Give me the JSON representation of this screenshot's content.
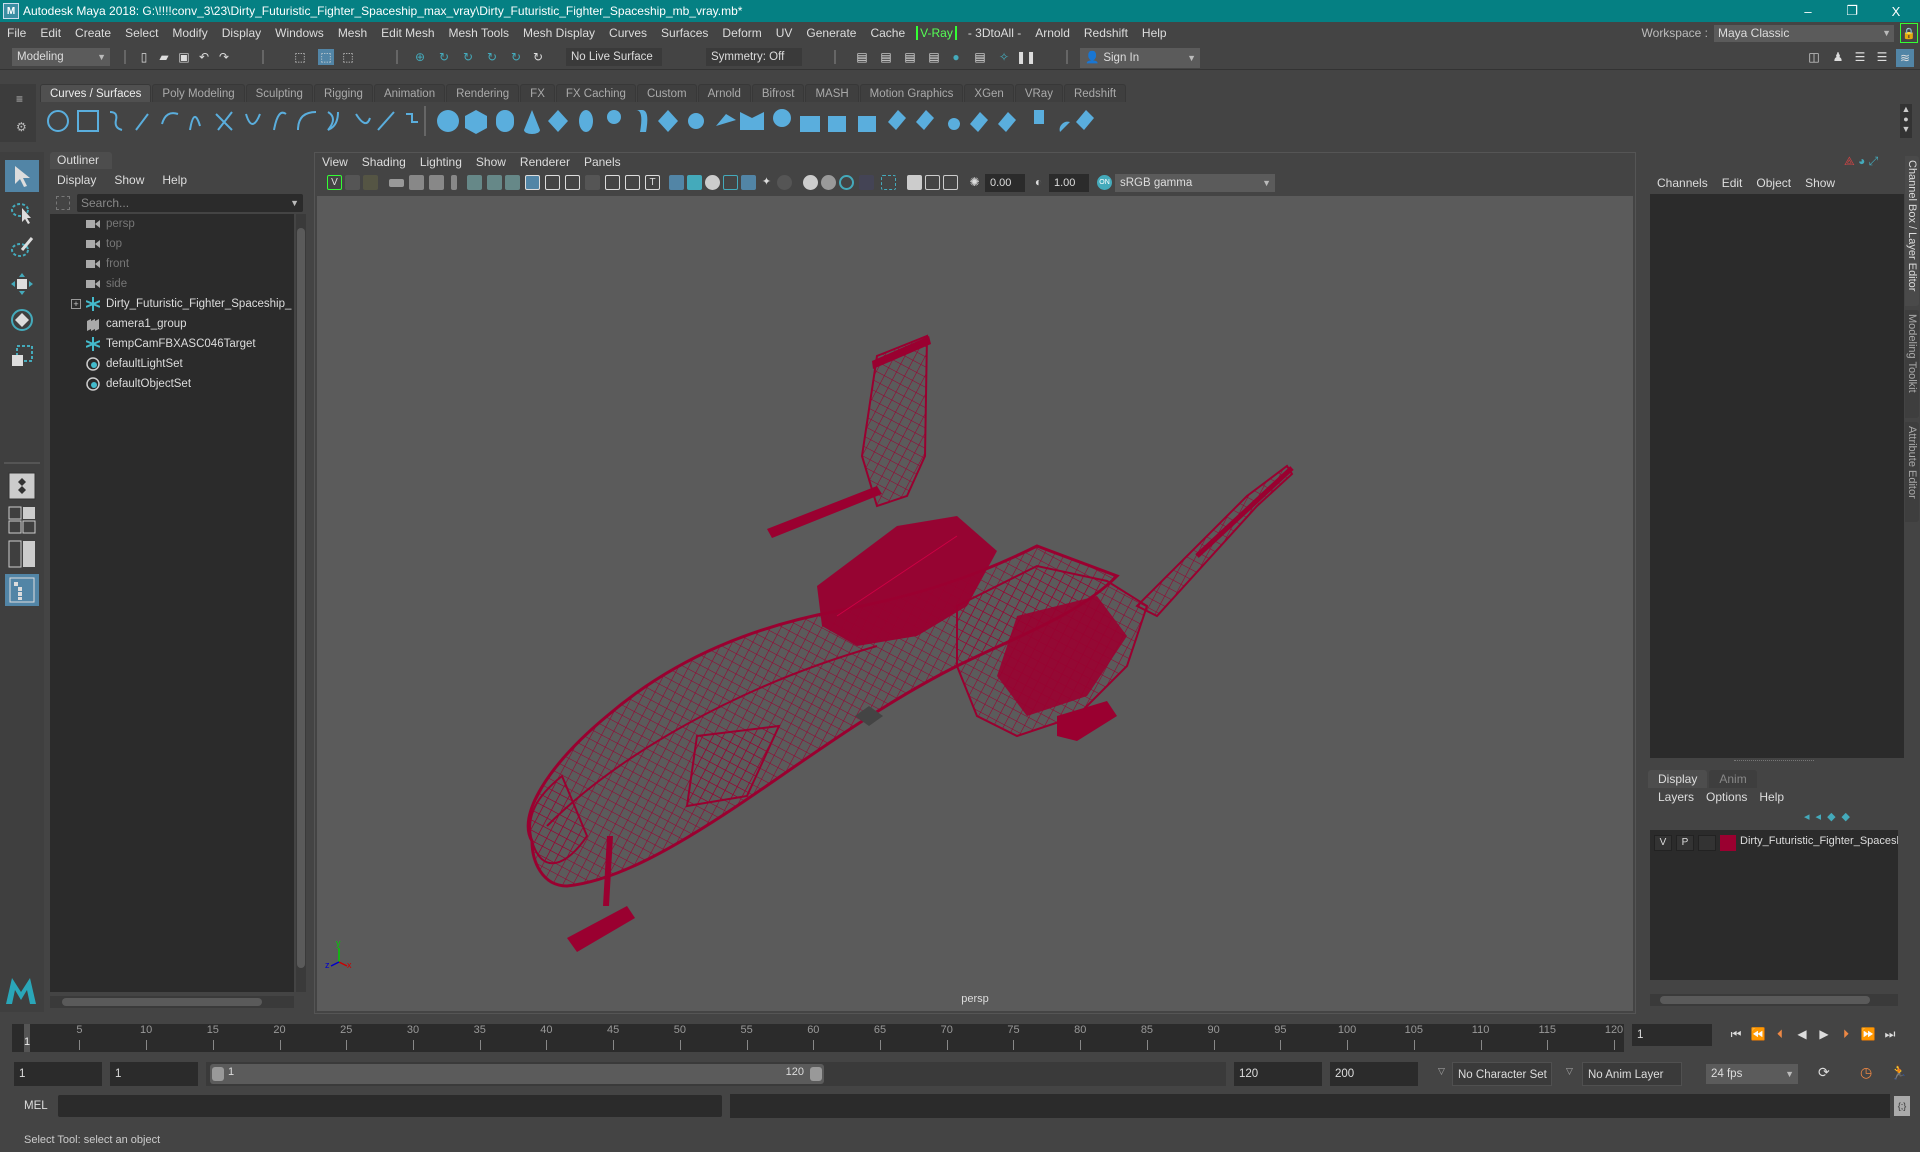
{
  "window": {
    "title": "Autodesk Maya 2018: G:\\!!!!conv_3\\23\\Dirty_Futuristic_Fighter_Spaceship_max_vray\\Dirty_Futuristic_Fighter_Spaceship_mb_vray.mb*",
    "logo": "M",
    "minimize": "–",
    "restore": "❐",
    "close": "X"
  },
  "menubar": {
    "items": [
      "File",
      "Edit",
      "Create",
      "Select",
      "Modify",
      "Display",
      "Windows",
      "Mesh",
      "Edit Mesh",
      "Mesh Tools",
      "Mesh Display",
      "Curves",
      "Surfaces",
      "Deform",
      "UV",
      "Generate",
      "Cache"
    ],
    "vray": "V-Ray",
    "items2": [
      "- 3DtoAll -",
      "Arnold",
      "Redshift",
      "Help"
    ]
  },
  "workspace": {
    "label": "Workspace :",
    "value": "Maya Classic",
    "lock_icon": "lock-icon"
  },
  "statusline": {
    "mode": "Modeling",
    "live_surface": "No Live Surface",
    "symmetry": "Symmetry: Off",
    "sign_in": "Sign In"
  },
  "shelf": {
    "tabs": [
      "Curves / Surfaces",
      "Poly Modeling",
      "Sculpting",
      "Rigging",
      "Animation",
      "Rendering",
      "FX",
      "FX Caching",
      "Custom",
      "Arnold",
      "Bifrost",
      "MASH",
      "Motion Graphics",
      "XGen",
      "VRay",
      "Redshift"
    ],
    "active_tab": "Curves / Surfaces"
  },
  "outliner": {
    "title": "Outliner",
    "menu": [
      "Display",
      "Show",
      "Help"
    ],
    "search_placeholder": "Search...",
    "items": [
      {
        "label": "persp",
        "icon": "camera-icon",
        "dim": true
      },
      {
        "label": "top",
        "icon": "camera-icon",
        "dim": true
      },
      {
        "label": "front",
        "icon": "camera-icon",
        "dim": true
      },
      {
        "label": "side",
        "icon": "camera-icon",
        "dim": true
      },
      {
        "label": "Dirty_Futuristic_Fighter_Spaceship_ncl",
        "icon": "transform-icon",
        "expandable": true
      },
      {
        "label": "camera1_group",
        "icon": "group-icon"
      },
      {
        "label": "TempCamFBXASC046Target",
        "icon": "transform-icon"
      },
      {
        "label": "defaultLightSet",
        "icon": "set-icon"
      },
      {
        "label": "defaultObjectSet",
        "icon": "set-icon"
      }
    ]
  },
  "viewport": {
    "menu": [
      "View",
      "Shading",
      "Lighting",
      "Show",
      "Renderer",
      "Panels"
    ],
    "exposure": "0.00",
    "gamma": "1.00",
    "color_space": "sRGB gamma",
    "camera_label": "persp",
    "axis": {
      "x": "x",
      "y": "y",
      "z": "z"
    },
    "wireframe_color": "#9a0030"
  },
  "channel_box": {
    "menu": [
      "Channels",
      "Edit",
      "Object",
      "Show"
    ]
  },
  "layer_editor": {
    "tabs": [
      "Display",
      "Anim"
    ],
    "menu": [
      "Layers",
      "Options",
      "Help"
    ],
    "layers": [
      {
        "v": "V",
        "p": "P",
        "color": "#9a0030",
        "name": "Dirty_Futuristic_Fighter_Spaceship"
      }
    ]
  },
  "side_tabs": [
    "Channel Box / Layer Editor",
    "Modeling Toolkit",
    "Attribute Editor"
  ],
  "timeline": {
    "ticks": [
      5,
      10,
      15,
      20,
      25,
      30,
      35,
      40,
      45,
      50,
      55,
      60,
      65,
      70,
      75,
      80,
      85,
      90,
      95,
      100,
      105,
      110,
      115,
      120
    ],
    "start": 1,
    "end": 120,
    "current_frame": "1",
    "current_frame_field": "1"
  },
  "range": {
    "start_field": "1",
    "playback_start": "1",
    "slider_start": "1",
    "slider_end": "120",
    "playback_end": "120",
    "end_field": "200",
    "character_set": "No Character Set",
    "anim_layer": "No Anim Layer",
    "fps": "24 fps"
  },
  "cmdline": {
    "label": "MEL"
  },
  "helpline": {
    "text": "Select Tool: select an object"
  }
}
